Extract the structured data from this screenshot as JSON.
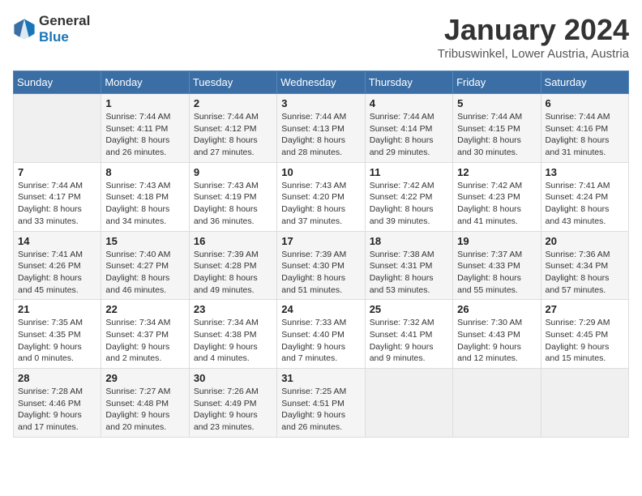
{
  "header": {
    "logo_line1": "General",
    "logo_line2": "Blue",
    "title": "January 2024",
    "subtitle": "Tribuswinkel, Lower Austria, Austria"
  },
  "days_of_week": [
    "Sunday",
    "Monday",
    "Tuesday",
    "Wednesday",
    "Thursday",
    "Friday",
    "Saturday"
  ],
  "weeks": [
    [
      {
        "num": "",
        "sunrise": "",
        "sunset": "",
        "daylight": "",
        "empty": true
      },
      {
        "num": "1",
        "sunrise": "Sunrise: 7:44 AM",
        "sunset": "Sunset: 4:11 PM",
        "daylight": "Daylight: 8 hours and 26 minutes."
      },
      {
        "num": "2",
        "sunrise": "Sunrise: 7:44 AM",
        "sunset": "Sunset: 4:12 PM",
        "daylight": "Daylight: 8 hours and 27 minutes."
      },
      {
        "num": "3",
        "sunrise": "Sunrise: 7:44 AM",
        "sunset": "Sunset: 4:13 PM",
        "daylight": "Daylight: 8 hours and 28 minutes."
      },
      {
        "num": "4",
        "sunrise": "Sunrise: 7:44 AM",
        "sunset": "Sunset: 4:14 PM",
        "daylight": "Daylight: 8 hours and 29 minutes."
      },
      {
        "num": "5",
        "sunrise": "Sunrise: 7:44 AM",
        "sunset": "Sunset: 4:15 PM",
        "daylight": "Daylight: 8 hours and 30 minutes."
      },
      {
        "num": "6",
        "sunrise": "Sunrise: 7:44 AM",
        "sunset": "Sunset: 4:16 PM",
        "daylight": "Daylight: 8 hours and 31 minutes."
      }
    ],
    [
      {
        "num": "7",
        "sunrise": "Sunrise: 7:44 AM",
        "sunset": "Sunset: 4:17 PM",
        "daylight": "Daylight: 8 hours and 33 minutes."
      },
      {
        "num": "8",
        "sunrise": "Sunrise: 7:43 AM",
        "sunset": "Sunset: 4:18 PM",
        "daylight": "Daylight: 8 hours and 34 minutes."
      },
      {
        "num": "9",
        "sunrise": "Sunrise: 7:43 AM",
        "sunset": "Sunset: 4:19 PM",
        "daylight": "Daylight: 8 hours and 36 minutes."
      },
      {
        "num": "10",
        "sunrise": "Sunrise: 7:43 AM",
        "sunset": "Sunset: 4:20 PM",
        "daylight": "Daylight: 8 hours and 37 minutes."
      },
      {
        "num": "11",
        "sunrise": "Sunrise: 7:42 AM",
        "sunset": "Sunset: 4:22 PM",
        "daylight": "Daylight: 8 hours and 39 minutes."
      },
      {
        "num": "12",
        "sunrise": "Sunrise: 7:42 AM",
        "sunset": "Sunset: 4:23 PM",
        "daylight": "Daylight: 8 hours and 41 minutes."
      },
      {
        "num": "13",
        "sunrise": "Sunrise: 7:41 AM",
        "sunset": "Sunset: 4:24 PM",
        "daylight": "Daylight: 8 hours and 43 minutes."
      }
    ],
    [
      {
        "num": "14",
        "sunrise": "Sunrise: 7:41 AM",
        "sunset": "Sunset: 4:26 PM",
        "daylight": "Daylight: 8 hours and 45 minutes."
      },
      {
        "num": "15",
        "sunrise": "Sunrise: 7:40 AM",
        "sunset": "Sunset: 4:27 PM",
        "daylight": "Daylight: 8 hours and 46 minutes."
      },
      {
        "num": "16",
        "sunrise": "Sunrise: 7:39 AM",
        "sunset": "Sunset: 4:28 PM",
        "daylight": "Daylight: 8 hours and 49 minutes."
      },
      {
        "num": "17",
        "sunrise": "Sunrise: 7:39 AM",
        "sunset": "Sunset: 4:30 PM",
        "daylight": "Daylight: 8 hours and 51 minutes."
      },
      {
        "num": "18",
        "sunrise": "Sunrise: 7:38 AM",
        "sunset": "Sunset: 4:31 PM",
        "daylight": "Daylight: 8 hours and 53 minutes."
      },
      {
        "num": "19",
        "sunrise": "Sunrise: 7:37 AM",
        "sunset": "Sunset: 4:33 PM",
        "daylight": "Daylight: 8 hours and 55 minutes."
      },
      {
        "num": "20",
        "sunrise": "Sunrise: 7:36 AM",
        "sunset": "Sunset: 4:34 PM",
        "daylight": "Daylight: 8 hours and 57 minutes."
      }
    ],
    [
      {
        "num": "21",
        "sunrise": "Sunrise: 7:35 AM",
        "sunset": "Sunset: 4:35 PM",
        "daylight": "Daylight: 9 hours and 0 minutes."
      },
      {
        "num": "22",
        "sunrise": "Sunrise: 7:34 AM",
        "sunset": "Sunset: 4:37 PM",
        "daylight": "Daylight: 9 hours and 2 minutes."
      },
      {
        "num": "23",
        "sunrise": "Sunrise: 7:34 AM",
        "sunset": "Sunset: 4:38 PM",
        "daylight": "Daylight: 9 hours and 4 minutes."
      },
      {
        "num": "24",
        "sunrise": "Sunrise: 7:33 AM",
        "sunset": "Sunset: 4:40 PM",
        "daylight": "Daylight: 9 hours and 7 minutes."
      },
      {
        "num": "25",
        "sunrise": "Sunrise: 7:32 AM",
        "sunset": "Sunset: 4:41 PM",
        "daylight": "Daylight: 9 hours and 9 minutes."
      },
      {
        "num": "26",
        "sunrise": "Sunrise: 7:30 AM",
        "sunset": "Sunset: 4:43 PM",
        "daylight": "Daylight: 9 hours and 12 minutes."
      },
      {
        "num": "27",
        "sunrise": "Sunrise: 7:29 AM",
        "sunset": "Sunset: 4:45 PM",
        "daylight": "Daylight: 9 hours and 15 minutes."
      }
    ],
    [
      {
        "num": "28",
        "sunrise": "Sunrise: 7:28 AM",
        "sunset": "Sunset: 4:46 PM",
        "daylight": "Daylight: 9 hours and 17 minutes."
      },
      {
        "num": "29",
        "sunrise": "Sunrise: 7:27 AM",
        "sunset": "Sunset: 4:48 PM",
        "daylight": "Daylight: 9 hours and 20 minutes."
      },
      {
        "num": "30",
        "sunrise": "Sunrise: 7:26 AM",
        "sunset": "Sunset: 4:49 PM",
        "daylight": "Daylight: 9 hours and 23 minutes."
      },
      {
        "num": "31",
        "sunrise": "Sunrise: 7:25 AM",
        "sunset": "Sunset: 4:51 PM",
        "daylight": "Daylight: 9 hours and 26 minutes."
      },
      {
        "num": "",
        "sunrise": "",
        "sunset": "",
        "daylight": "",
        "empty": true
      },
      {
        "num": "",
        "sunrise": "",
        "sunset": "",
        "daylight": "",
        "empty": true
      },
      {
        "num": "",
        "sunrise": "",
        "sunset": "",
        "daylight": "",
        "empty": true
      }
    ]
  ]
}
